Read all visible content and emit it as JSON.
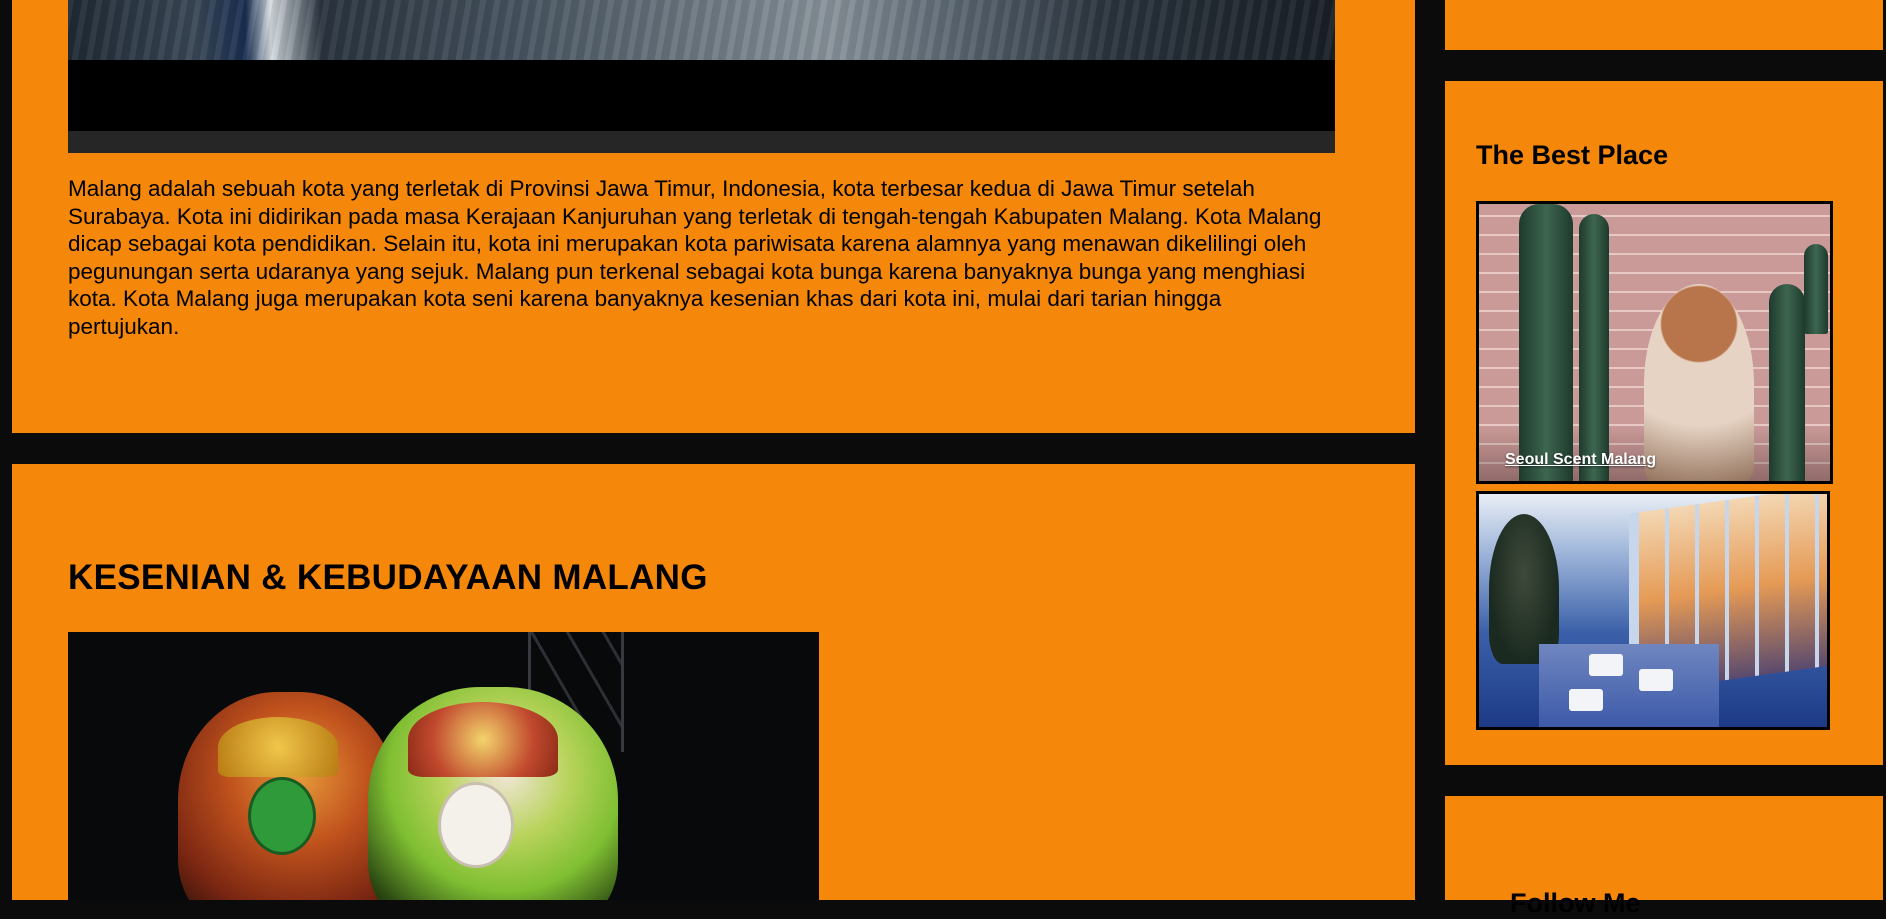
{
  "colors": {
    "background": "#0b0b0b",
    "panel": "#f5870a",
    "text": "#000000"
  },
  "article": {
    "paragraph": "Malang adalah sebuah kota yang terletak di Provinsi Jawa Timur, Indonesia, kota terbesar kedua di Jawa Timur setelah Surabaya. Kota ini didirikan pada masa Kerajaan Kanjuruhan yang terletak di tengah-tengah Kabupaten Malang. Kota Malang dicap sebagai kota pendidikan. Selain itu, kota ini merupakan kota pariwisata karena alamnya yang menawan dikelilingi oleh pegunungan serta udaranya yang sejuk. Malang pun terkenal sebagai kota bunga karena banyaknya bunga yang menghiasi kota. Kota Malang juga merupakan kota seni karena banyaknya kesenian khas dari kota ini, mulai dari tarian hingga pertujukan."
  },
  "section2": {
    "heading": "KESENIAN & KEBUDAYAAN MALANG"
  },
  "sidebar": {
    "best_place": {
      "title": "The Best Place",
      "cards": [
        {
          "caption": "Seoul Scent Malang"
        },
        {
          "caption": ""
        }
      ]
    },
    "follow": {
      "title": "Follow Me"
    }
  }
}
